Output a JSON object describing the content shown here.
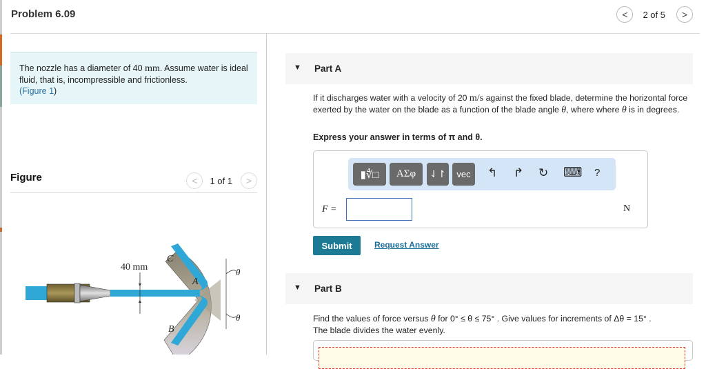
{
  "header": {
    "title": "Problem 6.09",
    "pager": {
      "count": "2 of 5",
      "prev": "<",
      "next": ">"
    }
  },
  "intro": {
    "text_before": "The nozzle has a diameter of 40 ",
    "unit": "mm",
    "text_after": ". Assume water is ideal fluid, that is, incompressible and frictionless.",
    "link_open": "(",
    "link": "Figure 1",
    "link_close": ")"
  },
  "figure": {
    "label": "Figure",
    "pager": {
      "count": "1 of 1",
      "prev": "<",
      "next": ">"
    },
    "labels": {
      "dimension": "40 mm",
      "C": "C",
      "A": "A",
      "B": "B",
      "theta_top": "θ",
      "theta_bottom": "θ"
    },
    "colors": {
      "water": "#2fa8d8",
      "blade": "#8c8474",
      "nozzle": "#8a7a45"
    }
  },
  "partA": {
    "label": "Part A",
    "q1": "If it discharges water with a velocity of 20 ",
    "q_unit": "m/s",
    "q2": " against the fixed blade, determine the horizontal force exerted by the water on the blade as a function of the blade angle ",
    "theta": "θ",
    "q3": ", where where ",
    "q4": " is in degrees.",
    "express": "Express your answer in terms of π and θ.",
    "toolbar": {
      "template_btn": "▮∜□",
      "greek_btn": "ΑΣφ",
      "arrows_btn": "⇃↾",
      "vec_btn": "vec",
      "undo": "↰",
      "redo": "↱",
      "reset": "↻",
      "keyboard": "⌨",
      "help": "?"
    },
    "answer_label": "F =",
    "answer_value": "",
    "unit": "N",
    "submit": "Submit",
    "request_answer": "Request Answer"
  },
  "partB": {
    "label": "Part B",
    "q1": "Find the values of force versus ",
    "q2": " for 0° ≤ θ ≤ 75° . Give values for increments of Δθ = 15° .",
    "q3": "The blade divides the water evenly."
  },
  "colors": {
    "accent": "#1c7a94",
    "link": "#2a72a8",
    "intro_bg": "#e6f5f7",
    "toolbar_bg": "#d3e5f7"
  }
}
